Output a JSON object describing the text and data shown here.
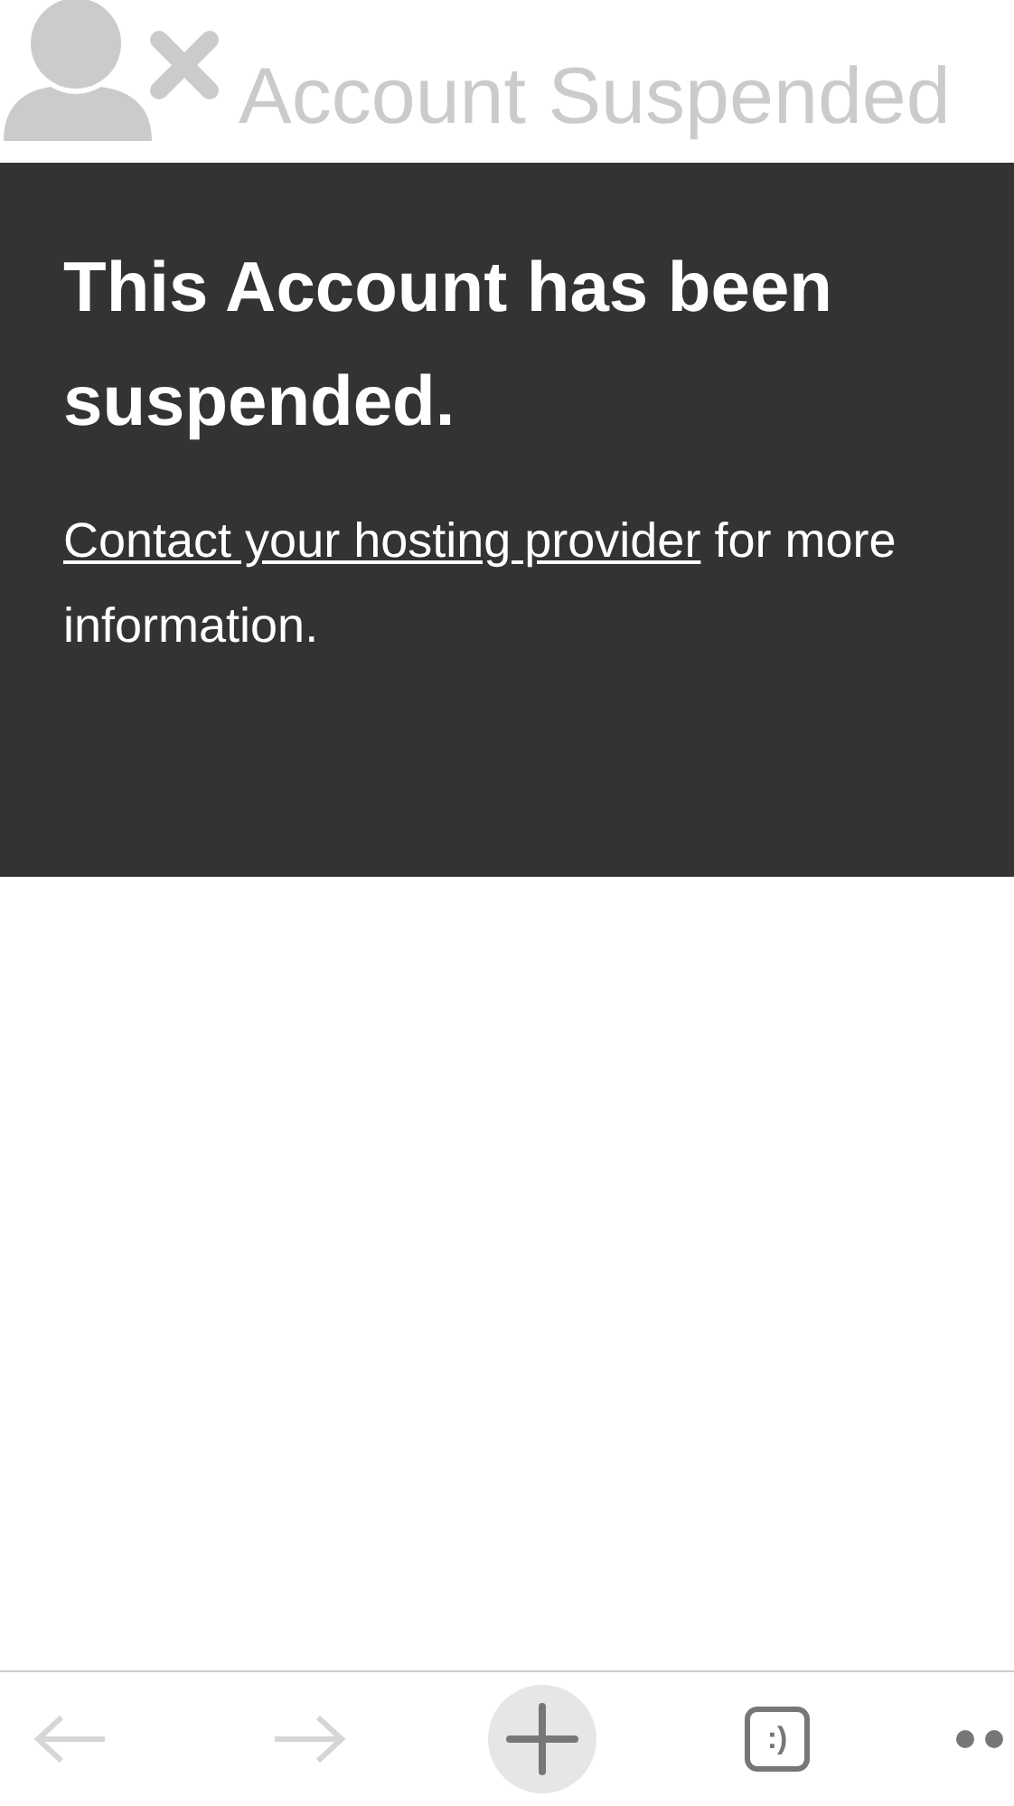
{
  "header": {
    "title": "Account Suspended"
  },
  "notice": {
    "heading": "This Account has been suspended.",
    "link": "Contact your hosting provider",
    "text": " for more information."
  },
  "toolbar": {
    "tab_count": ":)"
  }
}
